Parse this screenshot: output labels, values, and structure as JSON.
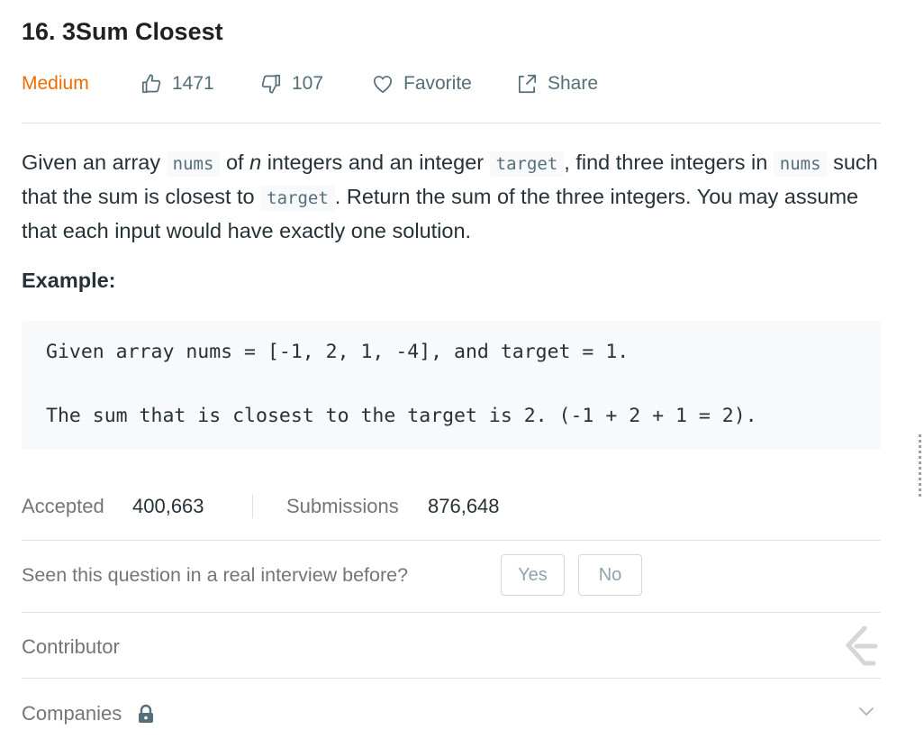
{
  "problem": {
    "title": "16. 3Sum Closest",
    "difficulty": "Medium",
    "likes": "1471",
    "dislikes": "107",
    "favorite_label": "Favorite",
    "share_label": "Share"
  },
  "description": {
    "p1": "Given an array ",
    "code1": "nums",
    "p2": " of ",
    "n": "n",
    "p3": " integers and an integer ",
    "code2": "target",
    "p4": ", find three integers in ",
    "code3": "nums",
    "p5": " such that the sum is closest to ",
    "code4": "target",
    "p6": ". Return the sum of the three integers. You may assume that each input would have exactly one solution."
  },
  "example": {
    "heading": "Example:",
    "line1": "Given array nums = [-1, 2, 1, -4], and target = 1.",
    "line2": "The sum that is closest to the target is 2. (-1 + 2 + 1 = 2)."
  },
  "stats": {
    "accepted_label": "Accepted",
    "accepted_value": "400,663",
    "submissions_label": "Submissions",
    "submissions_value": "876,648"
  },
  "interview": {
    "question": "Seen this question in a real interview before?",
    "yes_label": "Yes",
    "no_label": "No"
  },
  "contributor": {
    "label": "Contributor"
  },
  "companies": {
    "label": "Companies"
  },
  "colors": {
    "difficulty_medium": "#ef6c00",
    "text_primary": "#263238",
    "text_muted": "#757575",
    "code_bg": "#f7f9fa"
  },
  "icons": [
    "thumbs-up-icon",
    "thumbs-down-icon",
    "heart-icon",
    "share-icon",
    "leetcode-logo-icon",
    "lock-icon",
    "chevron-down-icon"
  ]
}
